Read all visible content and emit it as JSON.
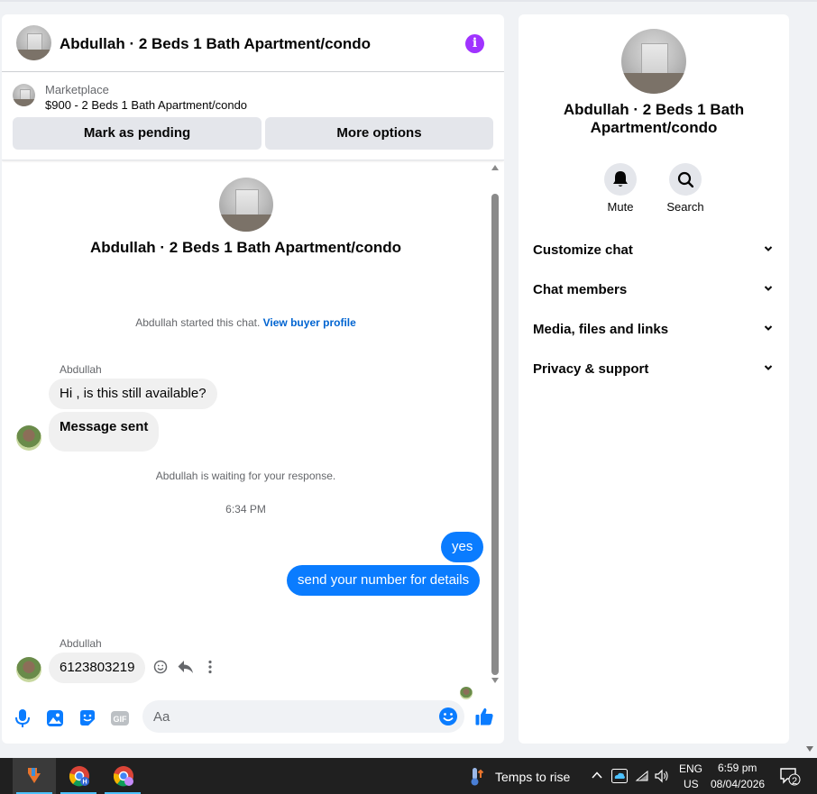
{
  "header": {
    "title": "Abdullah · 2 Beds 1 Bath Apartment/condo",
    "info_icon": "i"
  },
  "listing": {
    "source": "Marketplace",
    "price_title": "$900 - 2 Beds 1 Bath Apartment/condo",
    "mark_pending_label": "Mark as pending",
    "more_options_label": "More options"
  },
  "conversation": {
    "title": "Abdullah · 2 Beds 1 Bath Apartment/condo",
    "started_text": "Abdullah started this chat.",
    "view_profile_link": "View buyer profile",
    "sender_name": "Abdullah",
    "msg1": "Hi , is this still available?",
    "msg2": "Message sent",
    "waiting_text": "Abdullah is waiting for your response.",
    "time": "6:34 PM",
    "out1": "yes",
    "out2": "send your number for details",
    "sender_name_2": "Abdullah",
    "msg3": "6123803219"
  },
  "composer": {
    "placeholder": "Aa"
  },
  "side": {
    "title_line1": "Abdullah · 2 Beds 1 Bath",
    "title_line2": "Apartment/condo",
    "mute_label": "Mute",
    "search_label": "Search",
    "sections": [
      "Customize chat",
      "Chat members",
      "Media, files and links",
      "Privacy & support"
    ]
  },
  "taskbar": {
    "weather": "Temps to rise",
    "lang1": "ENG",
    "lang2": "US",
    "time": "6:59 pm",
    "date": "08/04/2026",
    "notif_count": "2"
  },
  "colors": {
    "accent": "#0a7cff",
    "info": "#a033ff",
    "bubble_in": "#f0f0f0",
    "taskbar": "#202020"
  }
}
